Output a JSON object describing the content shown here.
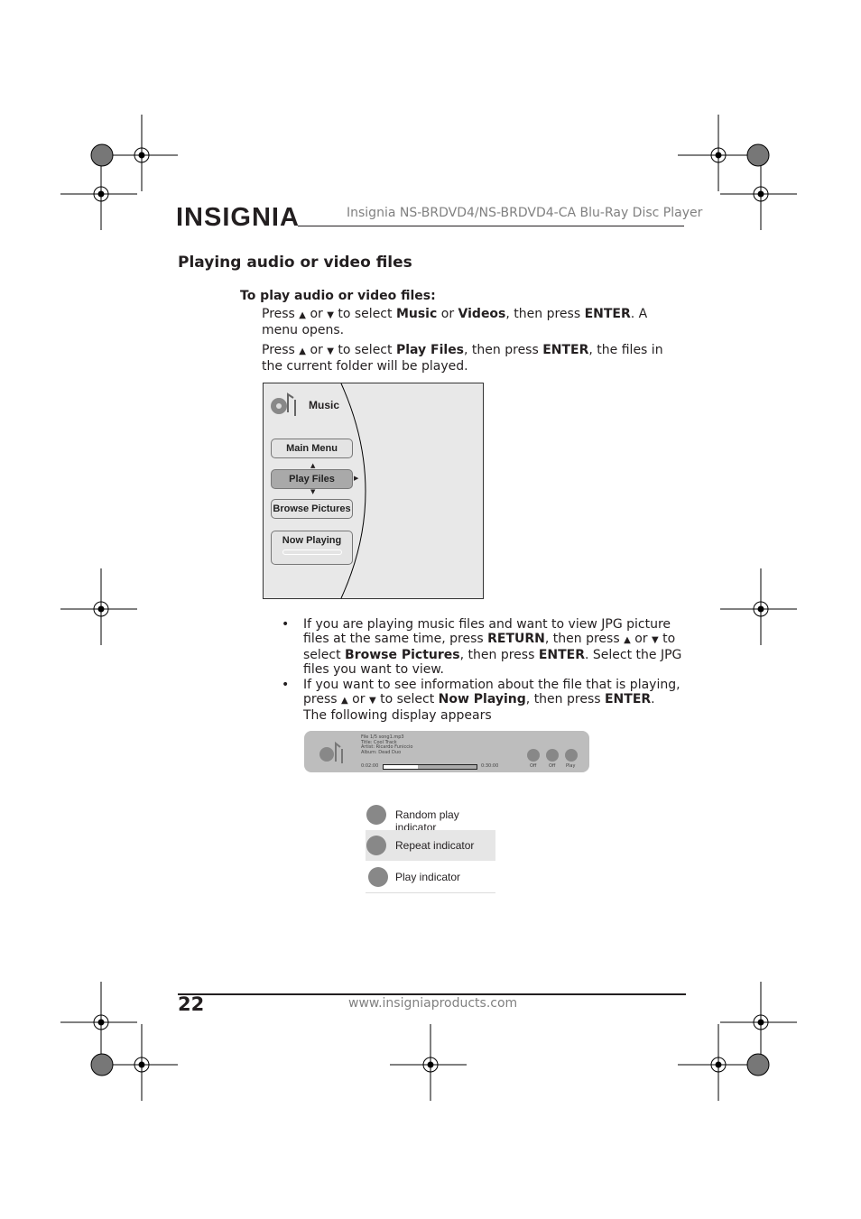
{
  "header": {
    "logo": "INSIGNIA",
    "title": "Insignia NS-BRDVD4/NS-BRDVD4-CA Blu-Ray Disc Player"
  },
  "section_title": "Playing audio or video files",
  "procedure": {
    "title": "To play audio or video files:",
    "step1": [
      "Press ",
      "▲",
      " or ",
      "▼",
      " to select ",
      "Music",
      " or ",
      "Videos",
      ", then press ",
      "ENTER",
      ". A menu opens."
    ],
    "step2": [
      "Press ",
      "▲",
      " or ",
      "▼",
      " to select ",
      "Play Files",
      ", then press ",
      "ENTER",
      ", the files in the current folder will be played."
    ]
  },
  "menu_screen": {
    "heading": "Music",
    "items": [
      "Main Menu",
      "Play Files",
      "Browse Pictures",
      "Now Playing"
    ],
    "selected": "Play Files"
  },
  "bullets": [
    [
      "If you are playing music files and want to view JPG picture files at the same time, press ",
      "RETURN",
      ", then press ",
      "▲",
      " or ",
      "▼",
      " to select ",
      "Browse Pictures",
      ", then press ",
      "ENTER",
      ". Select the JPG files you want to view."
    ],
    [
      "If you want to see information about the file that is playing, press ",
      "▲",
      " or ",
      "▼",
      " to select ",
      "Now Playing",
      ", then press ",
      "ENTER",
      ". The following display appears"
    ]
  ],
  "info_display": {
    "file": "File 1/5  song1.mp3",
    "title": "Title: Cool Track",
    "artist": "Artist:  Ricardo Funiccio",
    "album": "Album: Dead Duo",
    "elapsed": "0:02:00",
    "total": "0:30:00",
    "progress": 0.37,
    "indicators": [
      "Off",
      "Off",
      "Play"
    ]
  },
  "legend": [
    {
      "icon": "random-icon",
      "label": "Random play indicator"
    },
    {
      "icon": "repeat-icon",
      "label": "Repeat indicator"
    },
    {
      "icon": "play-icon",
      "label": "Play indicator"
    }
  ],
  "footer": {
    "page": "22",
    "url": "www.insigniaproducts.com"
  }
}
